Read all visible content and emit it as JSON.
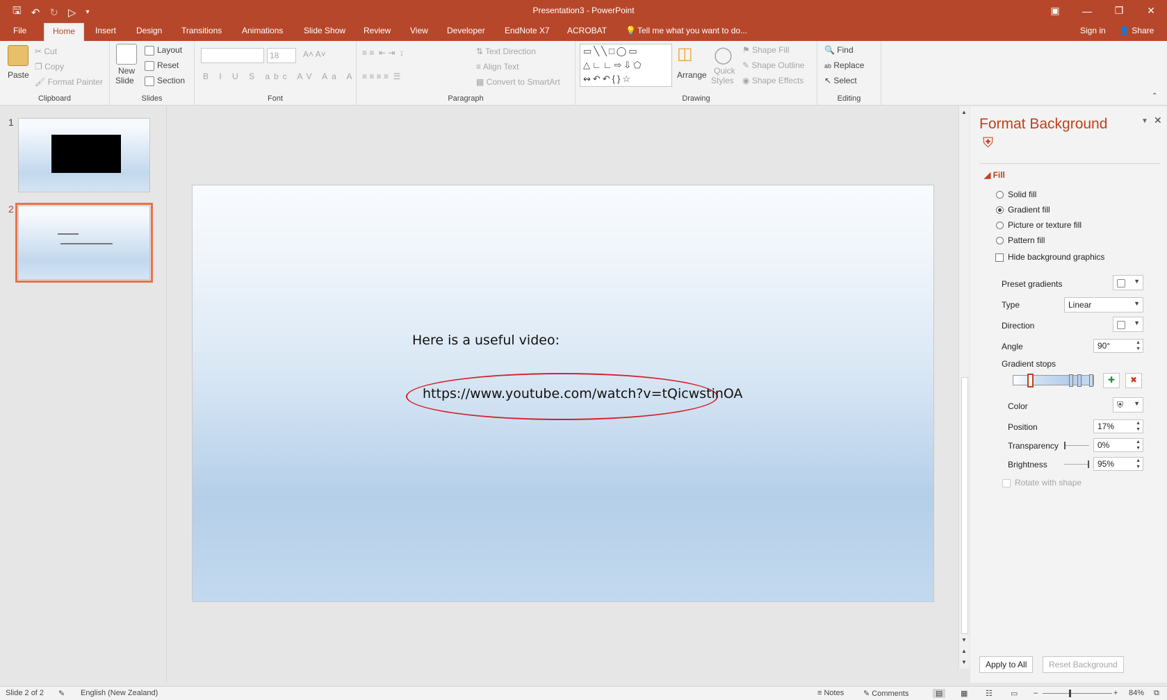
{
  "app": {
    "title": "Presentation3 - PowerPoint",
    "accent": "#b7472a"
  },
  "tabs": {
    "file": "File",
    "home": "Home",
    "insert": "Insert",
    "design": "Design",
    "transitions": "Transitions",
    "animations": "Animations",
    "slideshow": "Slide Show",
    "review": "Review",
    "view": "View",
    "developer": "Developer",
    "endnote": "EndNote X7",
    "acrobat": "ACROBAT",
    "tellme": "Tell me what you want to do...",
    "signin": "Sign in",
    "share": "Share"
  },
  "ribbon": {
    "clipboard": {
      "paste": "Paste",
      "cut": "Cut",
      "copy": "Copy",
      "format_painter": "Format Painter",
      "label": "Clipboard"
    },
    "slides": {
      "new_slide_1": "New",
      "new_slide_2": "Slide",
      "layout": "Layout",
      "reset": "Reset",
      "section": "Section",
      "label": "Slides"
    },
    "font": {
      "size": "18",
      "label": "Font"
    },
    "paragraph": {
      "text_direction": "Text Direction",
      "align_text": "Align Text",
      "convert_smartart": "Convert to SmartArt",
      "label": "Paragraph"
    },
    "drawing": {
      "arrange": "Arrange",
      "quick_styles_1": "Quick",
      "quick_styles_2": "Styles",
      "shape_fill": "Shape Fill",
      "shape_outline": "Shape Outline",
      "shape_effects": "Shape Effects",
      "label": "Drawing"
    },
    "editing": {
      "find": "Find",
      "replace": "Replace",
      "select": "Select",
      "label": "Editing"
    }
  },
  "thumbnails": [
    {
      "number": "1"
    },
    {
      "number": "2"
    }
  ],
  "slide": {
    "heading": "Here is a useful video:",
    "link": "https://www.youtube.com/watch?v=tQicwstinOA",
    "highlight_color": "#d4202a"
  },
  "format_pane": {
    "title": "Format Background",
    "section": "Fill",
    "fill_options": [
      "Solid fill",
      "Gradient fill",
      "Picture or texture fill",
      "Pattern fill"
    ],
    "selected_fill": "Gradient fill",
    "hide_bg": "Hide background graphics",
    "preset_gradients": "Preset gradients",
    "type_label": "Type",
    "type_value": "Linear",
    "direction_label": "Direction",
    "angle_label": "Angle",
    "angle_value": "90°",
    "gradient_stops": "Gradient stops",
    "color_label": "Color",
    "position_label": "Position",
    "position_value": "17%",
    "transparency_label": "Transparency",
    "transparency_value": "0%",
    "brightness_label": "Brightness",
    "brightness_value": "95%",
    "rotate_label": "Rotate with shape",
    "apply_all": "Apply to All",
    "reset_bg": "Reset Background"
  },
  "status": {
    "slide_info": "Slide 2 of 2",
    "language": "English (New Zealand)",
    "notes": "Notes",
    "comments": "Comments",
    "zoom": "84%"
  }
}
